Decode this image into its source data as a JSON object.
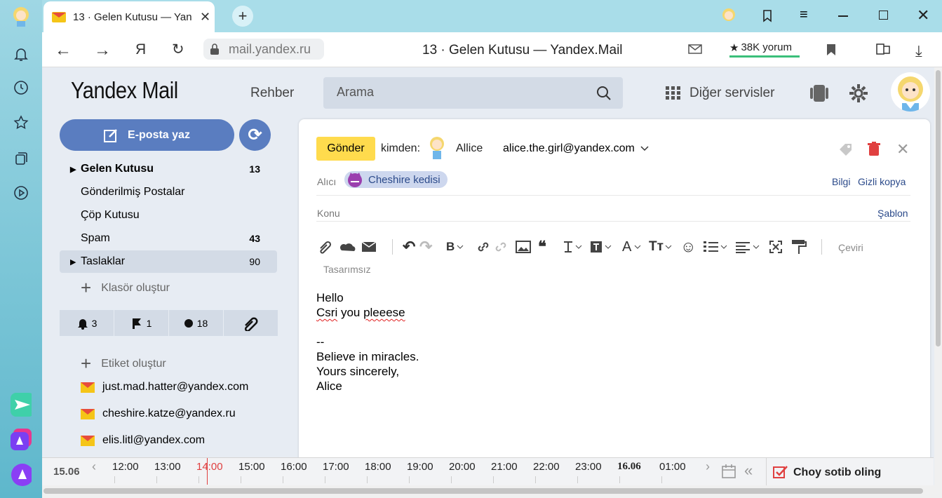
{
  "tab": {
    "title": "13 · Gelen Kutusu — Yan",
    "icon": "gmail-envelope-icon"
  },
  "address": {
    "url": "mail.yandex.ru",
    "page_title": "13 · Gelen Kutusu — Yandex.Mail",
    "reviews": "38K yorum",
    "ya": "Я"
  },
  "header": {
    "logo": "Yandex Mail",
    "contacts": "Rehber",
    "search_placeholder": "Arama",
    "services": "Diğer servisler"
  },
  "compose_button": "E-posta yaz",
  "folders": [
    {
      "label": "Gelen Kutusu",
      "count": "13",
      "bold": true,
      "arrow": "▶"
    },
    {
      "label": "Gönderilmiş Postalar",
      "count": ""
    },
    {
      "label": "Çöp Kutusu",
      "count": ""
    },
    {
      "label": "Spam",
      "count": "43"
    },
    {
      "label": "Taslaklar",
      "count": "90",
      "arrow": "▶"
    }
  ],
  "create_folder": "Klasör oluştur",
  "filters": {
    "reminders": "3",
    "flagged": "1",
    "unread": "18"
  },
  "create_label": "Etiket oluştur",
  "accounts": [
    "just.mad.hatter@yandex.com",
    "cheshire.katze@yandex.ru",
    "elis.litl@yandex.com"
  ],
  "compose": {
    "send": "Gönder",
    "from_label": "kimden:",
    "from_name": "Allice",
    "from_email": "alice.the.girl@yandex.com",
    "to_label": "Alıcı",
    "to_chip": "Cheshire kedisi",
    "cc": "Bilgi",
    "bcc": "Gizli kopya",
    "subject_label": "Konu",
    "template": "Şablon",
    "translate": "Çeviri",
    "no_design": "Tasarımsız",
    "body": {
      "l1": "Hello",
      "l2a": "Csri",
      "l2b": " you ",
      "l2c": "pleeese",
      "sig": "--",
      "s1": "Believe in miracles.",
      "s2": "Yours sincerely,",
      "s3": "Alice"
    }
  },
  "timeline": {
    "date_left": "15.06",
    "times": [
      "12:00",
      "13:00",
      "14:00",
      "15:00",
      "16:00",
      "17:00",
      "18:00",
      "19:00",
      "20:00",
      "21:00",
      "22:00",
      "23:00",
      "16.06",
      "01:00"
    ],
    "task": "Choy sotib oling"
  }
}
